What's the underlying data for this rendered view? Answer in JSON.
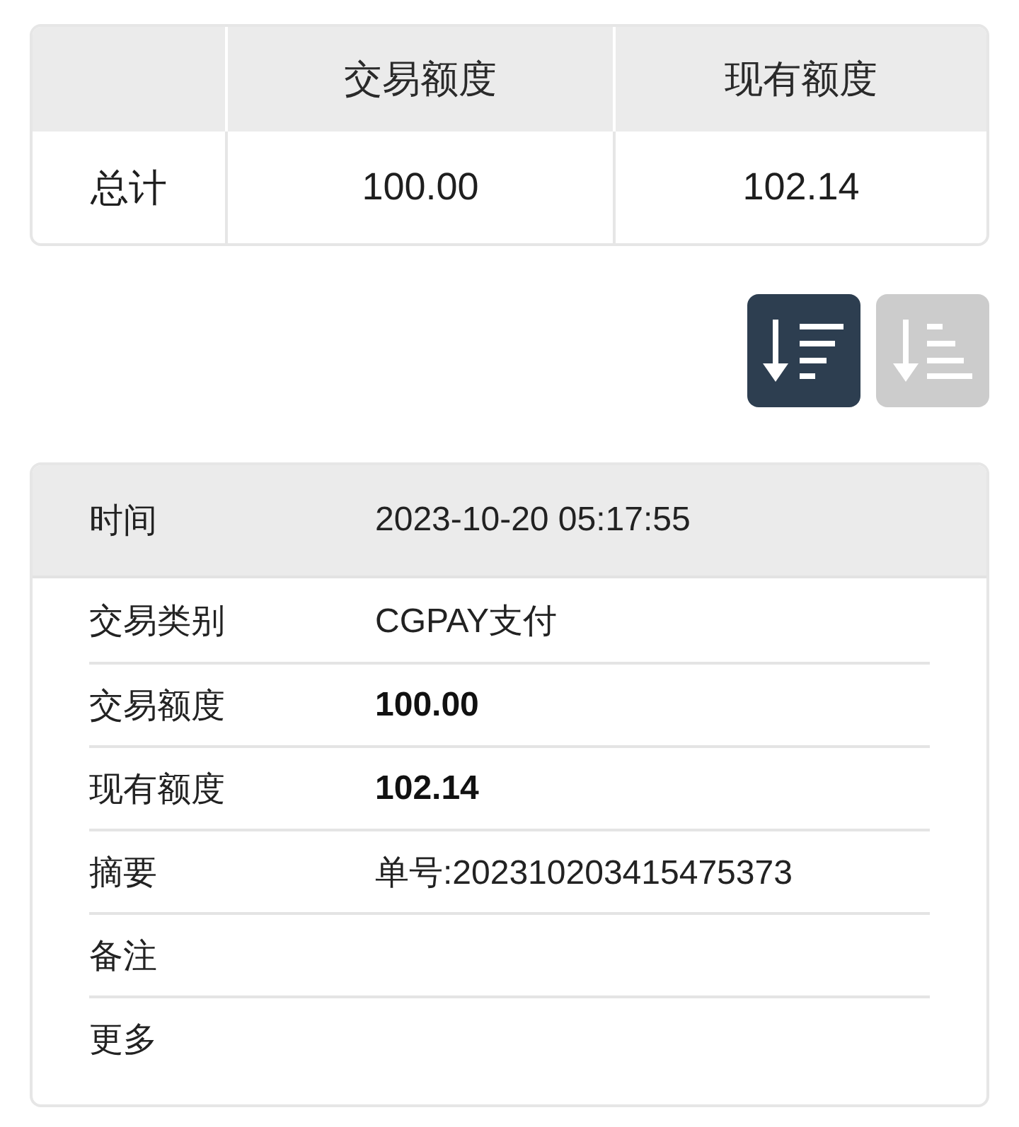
{
  "summary_table": {
    "columns": [
      "交易额度",
      "现有额度"
    ],
    "rows": [
      {
        "label": "总计",
        "cells": [
          "100.00",
          "102.14"
        ]
      }
    ]
  },
  "sort_buttons": [
    {
      "kind": "descending",
      "selected": true
    },
    {
      "kind": "ascending",
      "selected": false
    }
  ],
  "details": {
    "header": {
      "label": "时间",
      "value": "2023-10-20 05:17:55"
    },
    "rows": [
      {
        "label": "交易类别",
        "value": "CGPAY支付",
        "bold": false
      },
      {
        "label": "交易额度",
        "value": "100.00",
        "bold": true
      },
      {
        "label": "现有额度",
        "value": "102.14",
        "bold": true
      },
      {
        "label": "摘要",
        "value": "单号:202310203415475373",
        "bold": false
      },
      {
        "label": "备注"
      },
      {
        "label": "更多"
      }
    ]
  }
}
